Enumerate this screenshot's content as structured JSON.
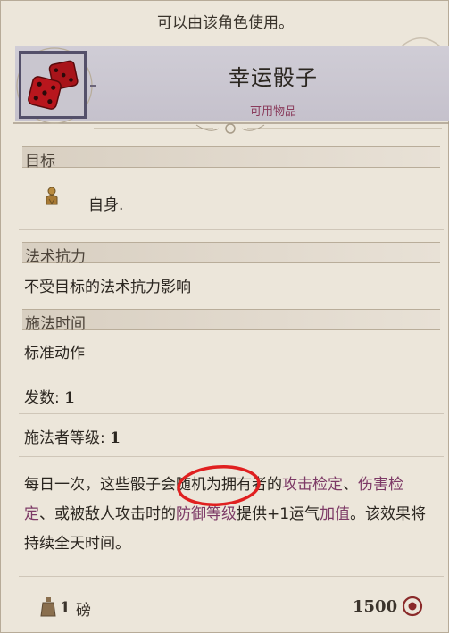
{
  "top_note": "可以由该角色使用。",
  "item": {
    "title": "幸运骰子",
    "subtitle": "可用物品",
    "icon": "dice-icon"
  },
  "sections": {
    "target_header": "目标",
    "target_value": "自身.",
    "resistance_header": "法术抗力",
    "resistance_value": "不受目标的法术抗力影响",
    "casting_header": "施法时间",
    "casting_value": "标准动作"
  },
  "stats": {
    "charges_label": "发数:",
    "charges_value": "1",
    "caster_level_label": "施法者等级:",
    "caster_level_value": "1"
  },
  "description": {
    "part1": "每日一次，这些骰子会随机为拥有者的",
    "link1": "攻击检定",
    "part2": "、",
    "link2": "伤害检定",
    "part3": "、或被敌人攻击时的",
    "link3": "防御等级",
    "part4": "提供+1运气",
    "link4": "加值",
    "part5": "。该效果将持续全天时间。"
  },
  "footer": {
    "weight_value": "1",
    "weight_unit": "磅",
    "price": "1500",
    "coin_icon": "coin-icon",
    "weight_icon": "weight-icon"
  },
  "colors": {
    "link": "#7d3a66",
    "annotation": "#e02020",
    "header_band": "#c9c6cf"
  }
}
